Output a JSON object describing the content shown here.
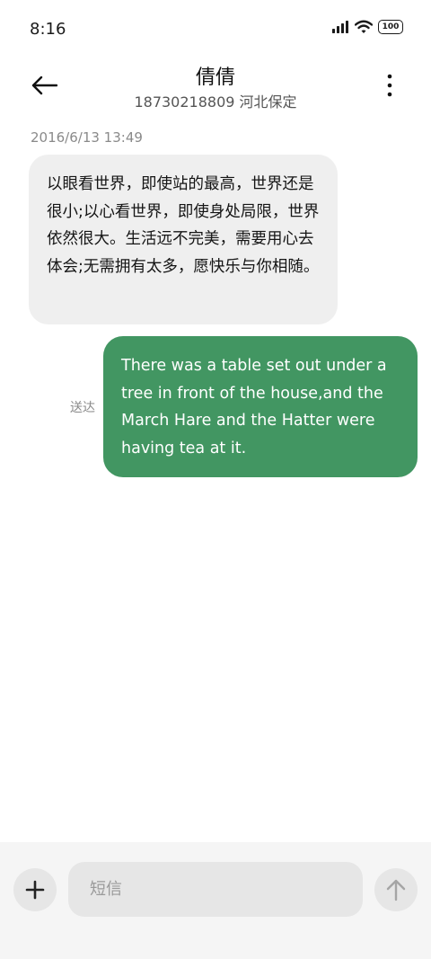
{
  "status_bar": {
    "time": "8:16",
    "battery": "100",
    "icons": [
      "signal-icon",
      "wifi-icon",
      "battery-icon"
    ]
  },
  "header": {
    "contact_name": "倩倩",
    "contact_detail": "18730218809 河北保定",
    "icons": [
      "back-arrow-icon",
      "more-vertical-icon"
    ]
  },
  "conversation": {
    "timestamp": "2016/6/13 13:49",
    "messages": [
      {
        "direction": "incoming",
        "text": "以眼看世界，即使站的最高，世界还是很小;以心看世界，即使身处局限，世界依然很大。生活远不完美，需要用心去体会;无需拥有太多，愿快乐与你相随。"
      },
      {
        "direction": "outgoing",
        "status": "送达",
        "text": "There was a table set out under a tree in front of the house,and the March Hare and the Hatter were having tea at it."
      }
    ]
  },
  "composer": {
    "placeholder": "短信",
    "value": "",
    "icons": [
      "plus-icon",
      "send-arrow-icon"
    ]
  },
  "colors": {
    "outgoing_bubble": "#429662",
    "incoming_bubble": "#efefef",
    "composer_background": "#f5f5f5"
  }
}
